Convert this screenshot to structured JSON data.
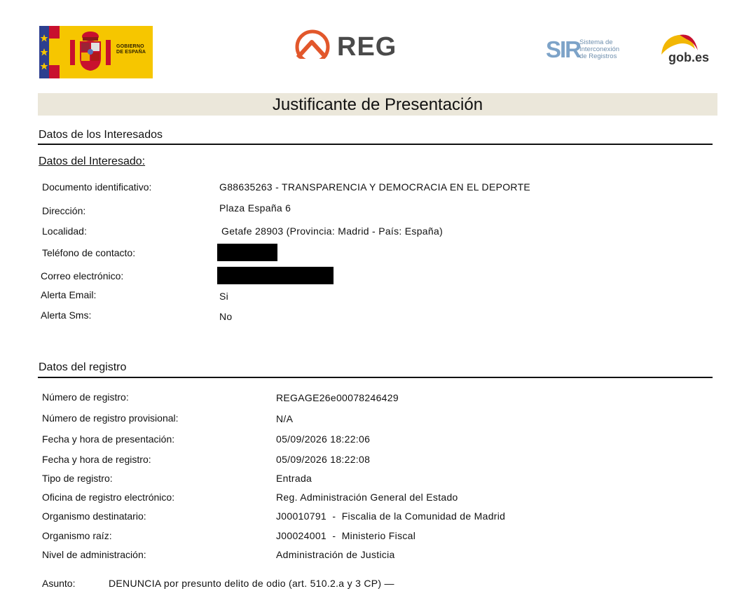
{
  "header": {
    "gobierno_logo_text": [
      "GOBIERNO",
      "DE ESPAÑA"
    ],
    "reg_logo_text": "REG",
    "sir_logo_mark": "SIR",
    "sir_logo_text": [
      "Sistema de",
      "Interconexión",
      "de Registros"
    ],
    "gobes_logo_text": "gob.es"
  },
  "title": "Justificante de Presentación",
  "interesados": {
    "section_title": "Datos de los Interesados",
    "subsection_title": "Datos del Interesado:",
    "fields": {
      "documento": {
        "label": "Documento identificativo:",
        "value": "G88635263 - TRANSPARENCIA Y DEMOCRACIA EN EL DEPORTE"
      },
      "direccion": {
        "label": "Dirección:",
        "value": "Plaza España 6"
      },
      "localidad": {
        "label": "Localidad:",
        "value": "Getafe 28903 (Provincia: Madrid - País: España)"
      },
      "telefono": {
        "label": "Teléfono de contacto:"
      },
      "correo": {
        "label": "Correo electrónico:"
      },
      "alerta_email": {
        "label": "Alerta Email:",
        "value": "Si"
      },
      "alerta_sms": {
        "label": "Alerta Sms:",
        "value": "No"
      }
    }
  },
  "registro": {
    "section_title": "Datos del registro",
    "fields": {
      "numero": {
        "label": "Número de registro:",
        "value": "REGAGE26e00078246429"
      },
      "numero_prov": {
        "label": "Número de registro provisional:",
        "value": "N/A"
      },
      "fecha_pres": {
        "label": "Fecha y hora de presentación:",
        "value": "05/09/2026 18:22:06"
      },
      "fecha_reg": {
        "label": "Fecha y hora de registro:",
        "value": "05/09/2026 18:22:08"
      },
      "tipo": {
        "label": "Tipo de registro:",
        "value": "Entrada"
      },
      "oficina": {
        "label": "Oficina de registro electrónico:",
        "value": "Reg. Administración General del Estado"
      },
      "destinatario": {
        "label": "Organismo destinatario:",
        "value": "J00010791  -  Fiscalia de la Comunidad de Madrid"
      },
      "raiz": {
        "label": "Organismo raíz:",
        "value": "J00024001  -  Ministerio Fiscal"
      },
      "nivel": {
        "label": "Nivel de administración:",
        "value": "Administración de Justicia"
      }
    }
  },
  "asunto": {
    "label": "Asunto:",
    "value": "DENUNCIA por presunto delito de odio (art. 510.2.a y 3 CP) —"
  },
  "colors": {
    "title_bg": "#ebe7da",
    "gobierno_yellow": "#f6c600",
    "eu_blue": "#2d3f8f",
    "spain_red": "#c8102e",
    "reg_orange": "#e2572b",
    "sir_blue": "#7da3c8"
  }
}
